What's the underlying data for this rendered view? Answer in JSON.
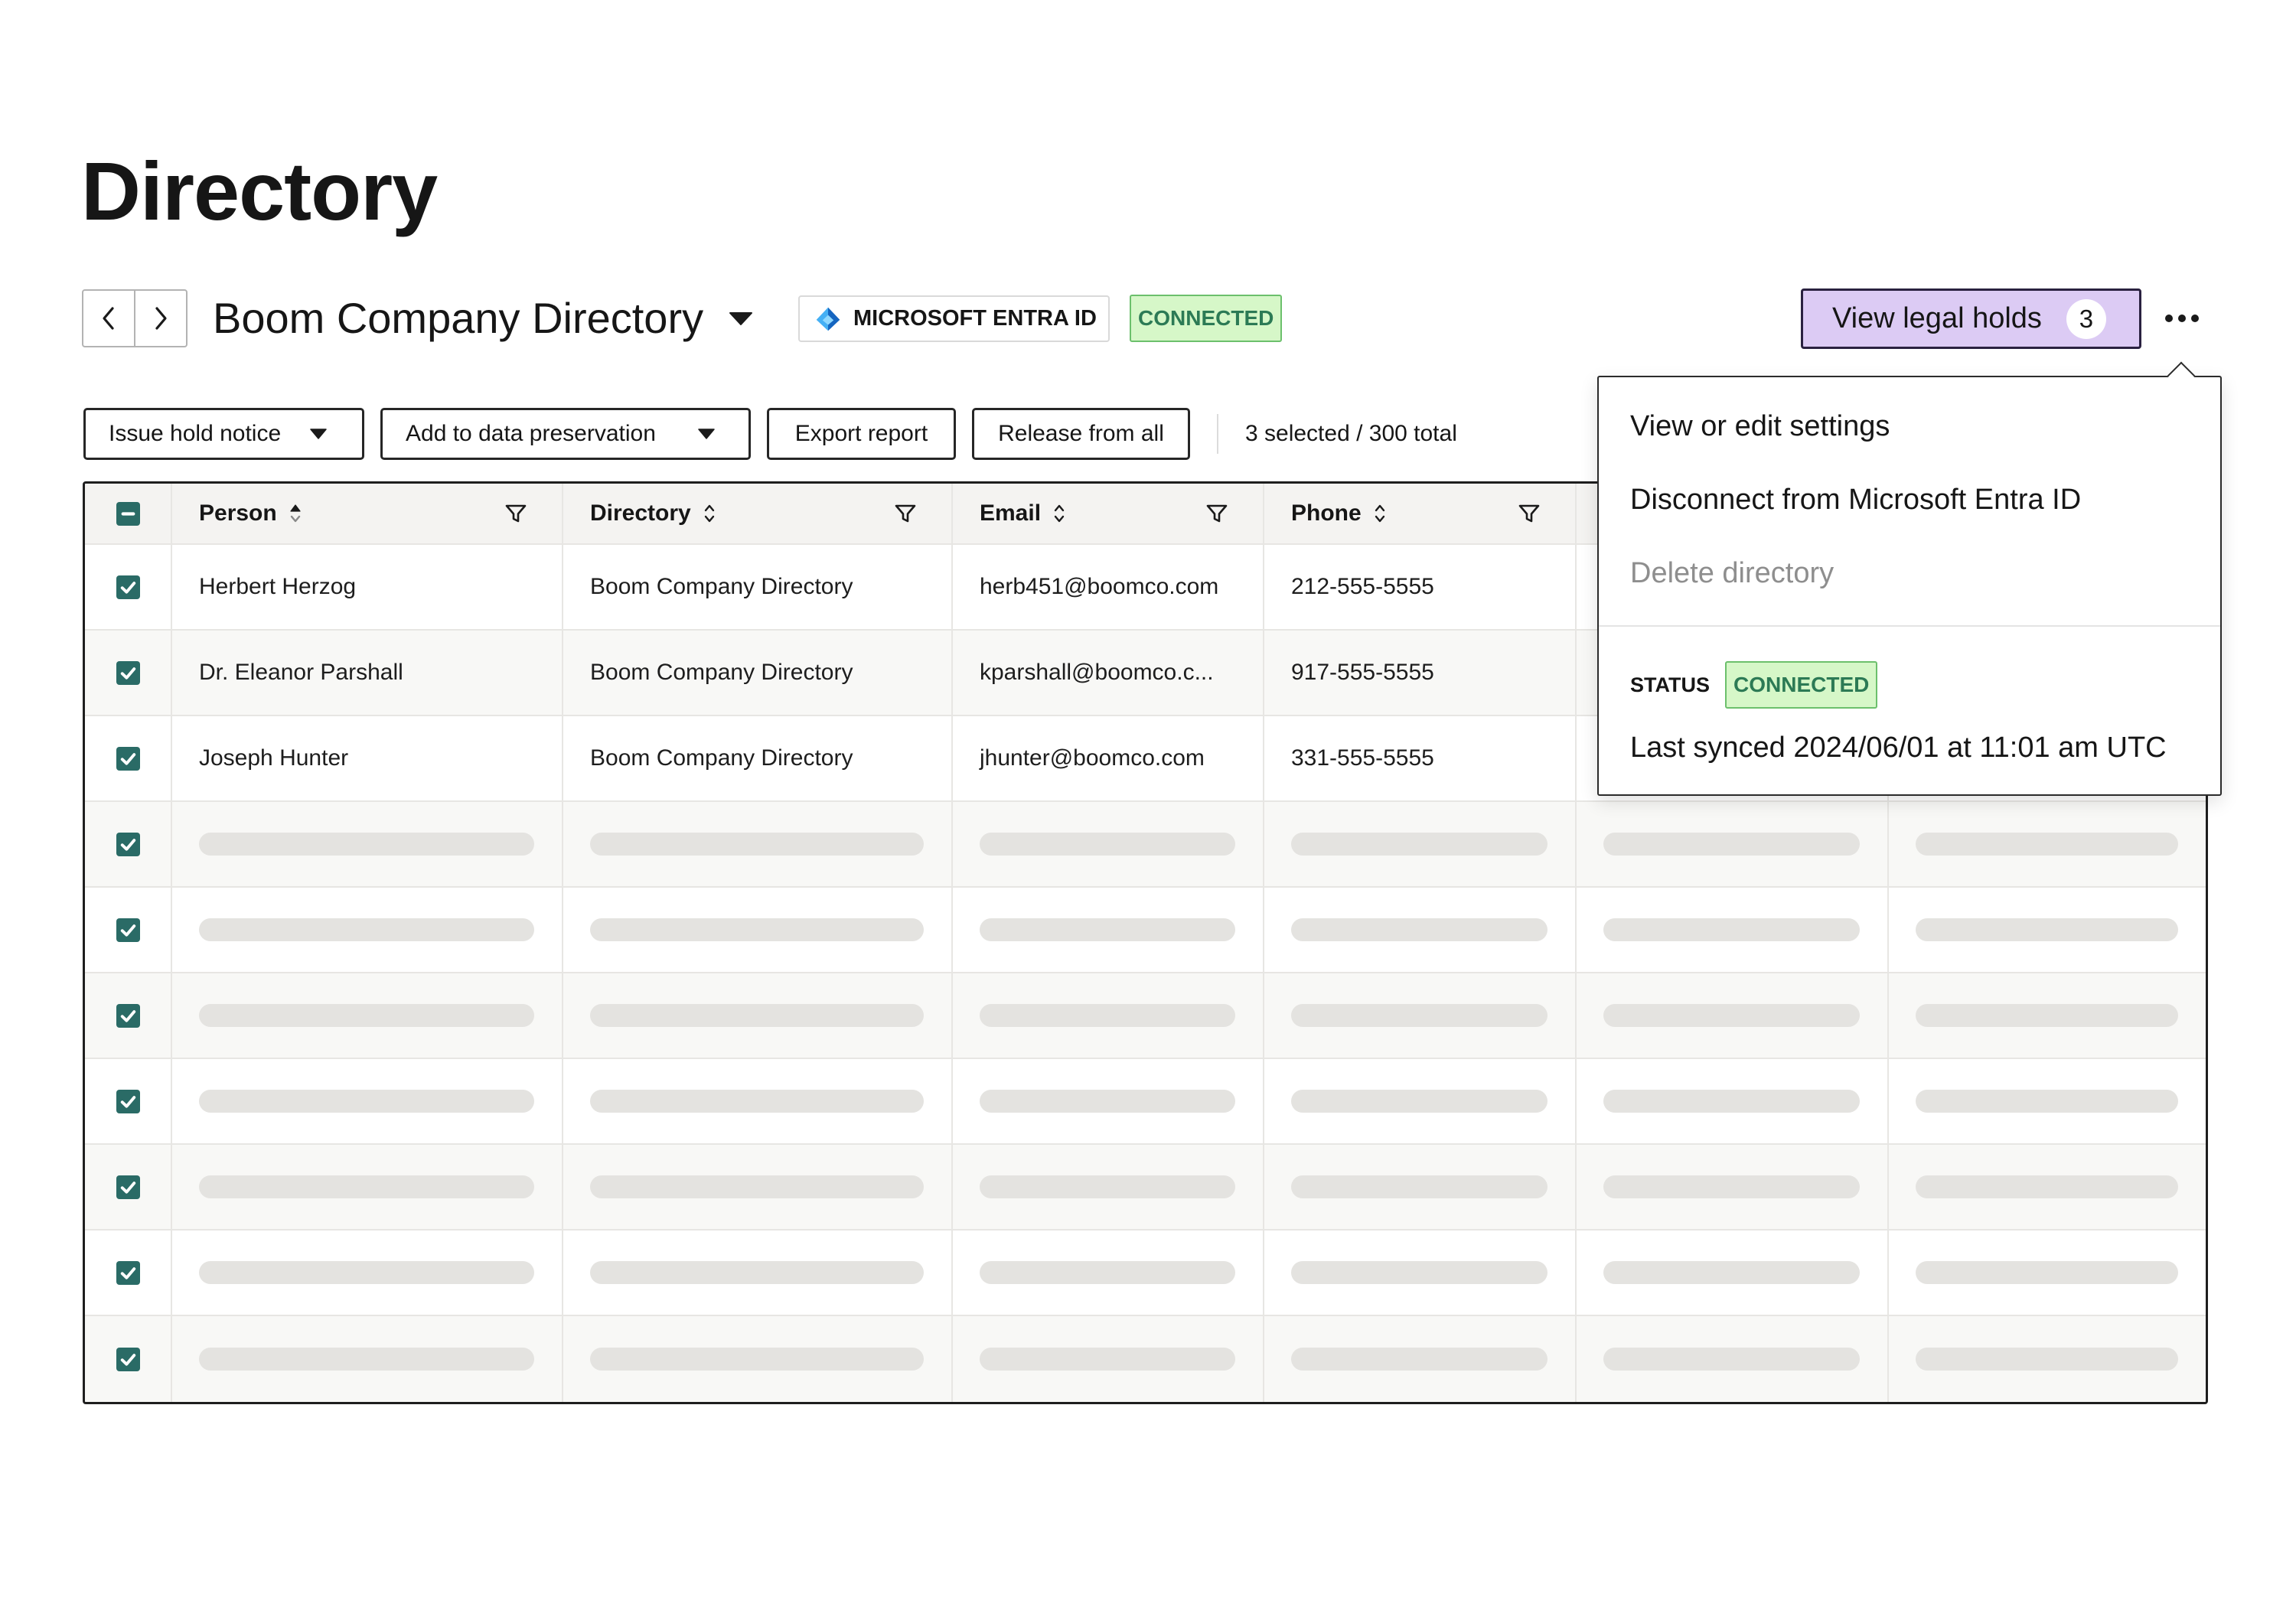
{
  "page": {
    "title": "Directory"
  },
  "header": {
    "directory_name": "Boom Company Directory",
    "provider": "MICROSOFT ENTRA ID",
    "connection_status": "CONNECTED",
    "legal_holds_label": "View legal holds",
    "legal_holds_count": "3"
  },
  "toolbar": {
    "issue_hold_notice": "Issue hold notice",
    "add_to_data_preservation": "Add to data preservation",
    "export_report": "Export report",
    "release_from_all": "Release from all",
    "selection_summary": "3 selected / 300 total"
  },
  "table": {
    "columns": [
      "Person",
      "Directory",
      "Email",
      "Phone"
    ],
    "rows": [
      {
        "selected": true,
        "person": "Herbert Herzog",
        "directory": "Boom Company Directory",
        "email": "herb451@boomco.com",
        "phone": "212-555-5555"
      },
      {
        "selected": true,
        "person": "Dr. Eleanor Parshall",
        "directory": "Boom Company Directory",
        "email": "kparshall@boomco.c...",
        "phone": "917-555-5555"
      },
      {
        "selected": true,
        "person": "Joseph Hunter",
        "directory": "Boom Company Directory",
        "email": "jhunter@boomco.com",
        "phone": "331-555-5555"
      },
      {
        "selected": true,
        "loading": true
      },
      {
        "selected": true,
        "loading": true
      },
      {
        "selected": true,
        "loading": true
      },
      {
        "selected": true,
        "loading": true
      },
      {
        "selected": true,
        "loading": true
      },
      {
        "selected": true,
        "loading": true
      },
      {
        "selected": true,
        "loading": true
      }
    ]
  },
  "more_menu": {
    "items": [
      {
        "label": "View or edit settings",
        "disabled": false
      },
      {
        "label": "Disconnect from Microsoft Entra ID",
        "disabled": false
      },
      {
        "label": "Delete directory",
        "disabled": true
      }
    ],
    "status_label": "STATUS",
    "status": "CONNECTED",
    "last_synced": "Last synced 2024/06/01 at 11:01 am UTC"
  },
  "colors": {
    "accent_teal": "#2a6b66",
    "connected_bg": "#d6f7c8",
    "connected_border": "#6cc06c",
    "connected_text": "#2c7a55",
    "legal_holds_bg": "#dccbf4",
    "disabled_text": "#8e8e8e",
    "skeleton": "#e4e3e0"
  },
  "icons": [
    "chevron-left-icon",
    "chevron-right-icon",
    "caret-down-icon",
    "microsoft-entra-icon",
    "more-horizontal-icon",
    "sort-ascending-icon",
    "sort-icon",
    "filter-icon",
    "checkbox-checked-icon",
    "checkbox-indeterminate-icon"
  ]
}
